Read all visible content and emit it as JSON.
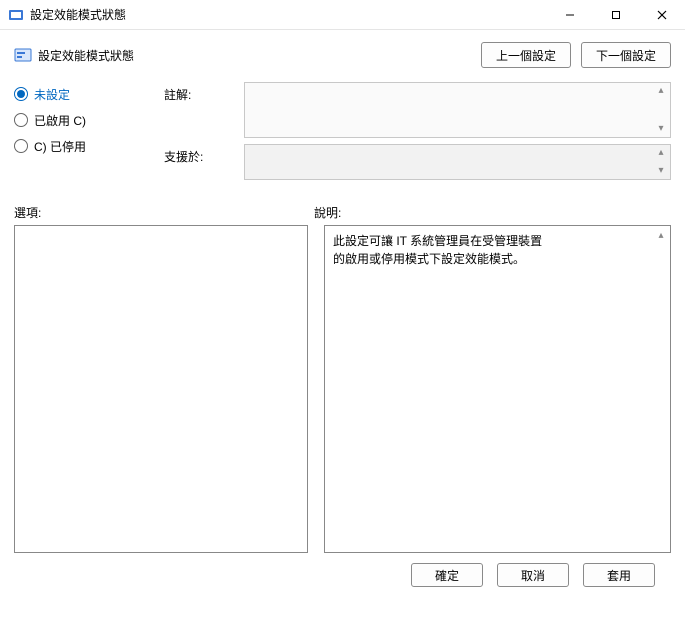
{
  "window": {
    "title": "設定效能模式狀態"
  },
  "header": {
    "title": "設定效能模式狀態",
    "prev_button": "上一個設定",
    "next_button": "下一個設定"
  },
  "radios": {
    "not_configured": "未設定",
    "enabled": "已啟用 C)",
    "disabled": "C) 已停用"
  },
  "labels": {
    "comment": "註解:",
    "supported": "支援於:",
    "options": "選項:",
    "help": "說明:"
  },
  "help": {
    "line1": "此設定可讓 IT 系統管理員在受管理裝置",
    "line2": "的啟用或停用模式下設定效能模式。"
  },
  "buttons": {
    "ok": "確定",
    "cancel": "取消",
    "apply": "套用"
  }
}
